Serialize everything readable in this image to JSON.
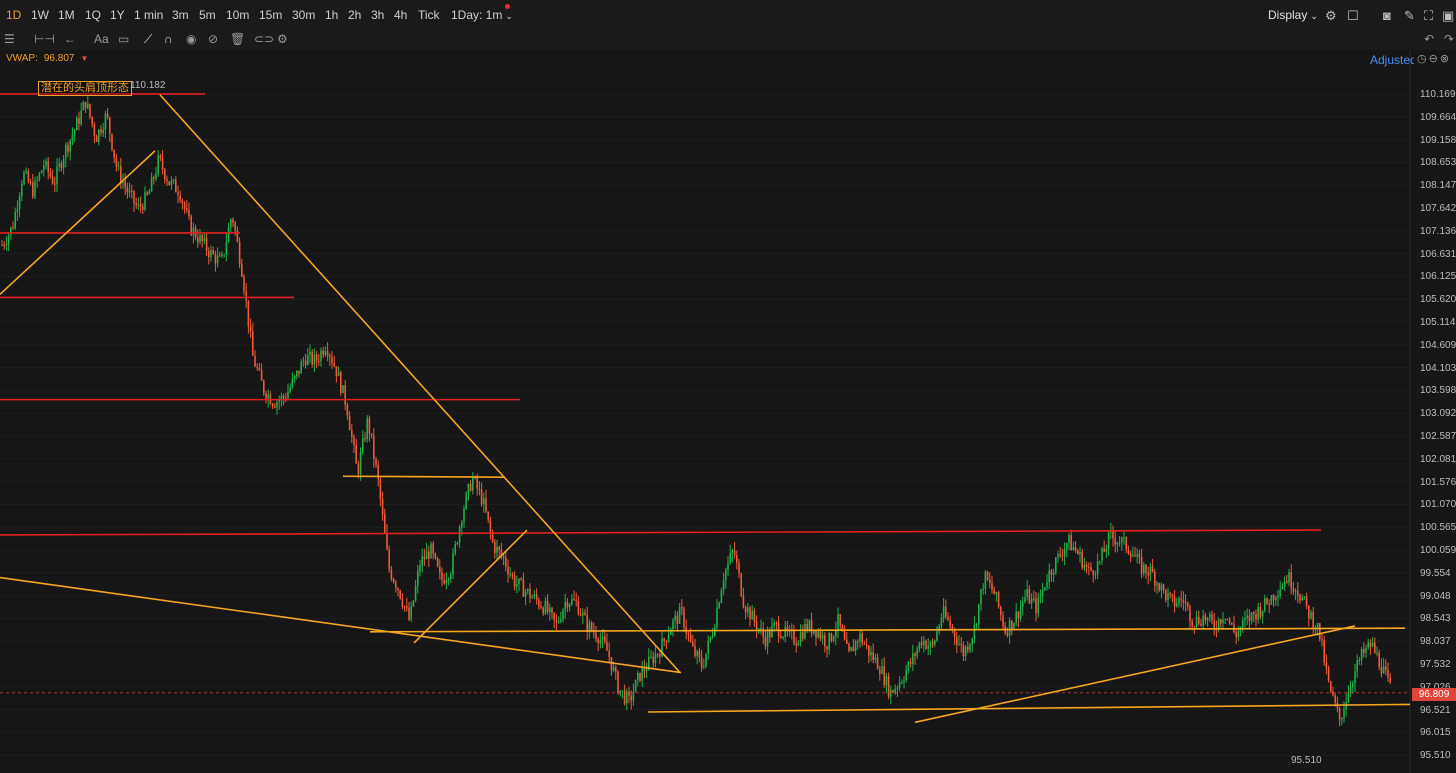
{
  "toolbar": {
    "timeframes": [
      {
        "label": "1D",
        "active": true
      },
      {
        "label": "1W",
        "active": false
      },
      {
        "label": "1M",
        "active": false
      },
      {
        "label": "1Q",
        "active": false
      },
      {
        "label": "1Y",
        "active": false
      },
      {
        "label": "1 min",
        "active": false
      },
      {
        "label": "3m",
        "active": false
      },
      {
        "label": "5m",
        "active": false
      },
      {
        "label": "10m",
        "active": false
      },
      {
        "label": "15m",
        "active": false
      },
      {
        "label": "30m",
        "active": false
      },
      {
        "label": "1h",
        "active": false
      },
      {
        "label": "2h",
        "active": false
      },
      {
        "label": "3h",
        "active": false
      },
      {
        "label": "4h",
        "active": false
      },
      {
        "label": "Tick",
        "active": false
      }
    ],
    "interval_select": "1Day: 1m",
    "display_label": "Display",
    "right_icons": [
      "settings-icon",
      "layout-icon",
      "camera-icon",
      "pen-icon",
      "fullscreen-icon",
      "window-icon"
    ],
    "drawing_tools": [
      "indicators-icon",
      "bar-type-icon",
      "undo-arrow-icon",
      "text-style-icon",
      "comment-icon",
      "line-tool-icon",
      "magnet-icon",
      "eye-icon",
      "hide-icon",
      "trash-icon",
      "link-icon",
      "gear-icon"
    ]
  },
  "indicator": {
    "label": "VWAP:",
    "value": "96.807"
  },
  "adjusted_label": "Adjusted",
  "annotations": {
    "pattern": "潜在的头肩顶形态",
    "high": "110.182",
    "low": "95.510"
  },
  "price_axis": [
    "110.169",
    "109.664",
    "109.158",
    "108.653",
    "108.147",
    "107.642",
    "107.136",
    "106.631",
    "106.125",
    "105.620",
    "105.114",
    "104.609",
    "104.103",
    "103.598",
    "103.092",
    "102.587",
    "102.081",
    "101.576",
    "101.070",
    "100.565",
    "100.059",
    "99.554",
    "99.048",
    "98.543",
    "98.037",
    "97.532",
    "97.026",
    "96.521",
    "96.015",
    "95.510"
  ],
  "current_price": "96.809",
  "colors": {
    "up": "#1fb14a",
    "down": "#f05a38",
    "trend": "#f5a623",
    "resistance": "#e02020",
    "background": "#161616"
  },
  "chart_data": {
    "type": "candlestick",
    "title": "",
    "xlabel": "",
    "ylabel": "",
    "ylim": [
      95.3,
      110.5
    ],
    "close_path": [
      106.8,
      107.2,
      108.4,
      108.0,
      108.6,
      108.2,
      108.9,
      109.4,
      110.0,
      109.2,
      109.7,
      108.5,
      108.0,
      107.6,
      107.9,
      108.7,
      108.2,
      108.0,
      107.2,
      106.9,
      106.6,
      106.4,
      107.5,
      106.2,
      104.3,
      103.6,
      103.3,
      103.4,
      103.8,
      104.3,
      104.2,
      104.6,
      104.0,
      103.2,
      101.7,
      102.9,
      101.5,
      99.6,
      99.1,
      98.4,
      99.7,
      100.0,
      99.3,
      99.6,
      100.8,
      101.6,
      101.1,
      100.1,
      99.8,
      99.3,
      99.1,
      98.9,
      98.7,
      98.3,
      98.9,
      98.8,
      98.3,
      98.1,
      97.7,
      96.9,
      96.6,
      97.2,
      97.5,
      97.8,
      98.3,
      98.6,
      97.8,
      97.4,
      98.2,
      99.4,
      100.0,
      98.8,
      98.4,
      98.0,
      98.3,
      98.1,
      98.0,
      98.3,
      98.2,
      97.9,
      98.4,
      97.6,
      98.1,
      97.7,
      97.4,
      96.8,
      97.1,
      97.5,
      98.0,
      97.8,
      98.6,
      98.2,
      97.7,
      98.2,
      99.4,
      99.0,
      98.2,
      98.5,
      99.0,
      98.7,
      99.4,
      99.8,
      100.2,
      99.9,
      99.5,
      99.7,
      100.3,
      100.2,
      100.0,
      99.6,
      99.5,
      99.1,
      98.8,
      98.9,
      98.4,
      98.5,
      98.3,
      98.6,
      98.1,
      98.4,
      98.6,
      98.8,
      99.1,
      99.4,
      99.1,
      98.6,
      98.2,
      96.9,
      96.2,
      97.0,
      97.6,
      97.9,
      97.4,
      96.8
    ]
  },
  "drawn_lines": [
    {
      "kind": "resistance",
      "p1": [
        0,
        110.17
      ],
      "p2": [
        205,
        110.17
      ]
    },
    {
      "kind": "resistance",
      "p1": [
        0,
        107.07
      ],
      "p2": [
        240,
        107.07
      ]
    },
    {
      "kind": "resistance",
      "p1": [
        0,
        105.63
      ],
      "p2": [
        294,
        105.63
      ]
    },
    {
      "kind": "resistance",
      "p1": [
        0,
        103.35
      ],
      "p2": [
        520,
        103.35
      ]
    },
    {
      "kind": "resistance",
      "p1": [
        0,
        100.33
      ],
      "p2": [
        1321,
        100.44
      ]
    },
    {
      "kind": "trend",
      "p1": [
        0,
        105.7
      ],
      "p2": [
        155,
        108.9
      ]
    },
    {
      "kind": "trend",
      "p1": [
        160,
        110.15
      ],
      "p2": [
        680,
        97.26
      ]
    },
    {
      "kind": "trend",
      "p1": [
        0,
        99.38
      ],
      "p2": [
        681,
        97.26
      ]
    },
    {
      "kind": "trend",
      "p1": [
        414,
        97.92
      ],
      "p2": [
        527,
        100.44
      ]
    },
    {
      "kind": "trend",
      "p1": [
        343,
        101.64
      ],
      "p2": [
        505,
        101.62
      ]
    },
    {
      "kind": "trend",
      "p1": [
        370,
        98.17
      ],
      "p2": [
        1405,
        98.25
      ]
    },
    {
      "kind": "trend",
      "p1": [
        648,
        96.38
      ],
      "p2": [
        1410,
        96.55
      ]
    },
    {
      "kind": "trend",
      "p1": [
        915,
        96.15
      ],
      "p2": [
        1355,
        98.3
      ]
    }
  ]
}
